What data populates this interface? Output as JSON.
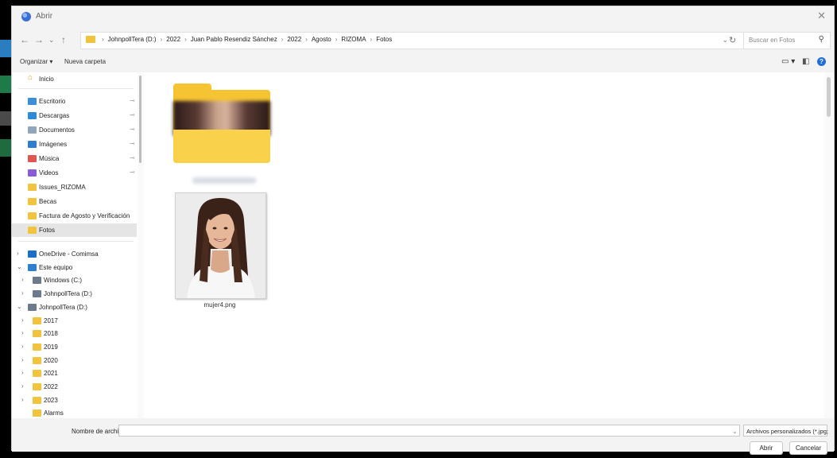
{
  "window": {
    "title": "Abrir"
  },
  "address": {
    "segments": [
      "JohnpollTera (D:)",
      "2022",
      "Juan Pablo Resendiz Sánchez",
      "2022",
      "Agosto",
      "RIZOMA",
      "Fotos"
    ]
  },
  "search": {
    "placeholder": "Buscar en Fotos"
  },
  "toolbar": {
    "organize": "Organizar ▾",
    "new_folder": "Nueva carpeta"
  },
  "sidebar": {
    "home": "Inicio",
    "quick": [
      {
        "label": "Escritorio",
        "icon": "desktop-icon",
        "pinned": true
      },
      {
        "label": "Descargas",
        "icon": "download-icon",
        "pinned": true
      },
      {
        "label": "Documentos",
        "icon": "documents-icon",
        "pinned": true
      },
      {
        "label": "Imágenes",
        "icon": "pictures-icon",
        "pinned": true
      },
      {
        "label": "Música",
        "icon": "music-icon",
        "pinned": true
      },
      {
        "label": "Videos",
        "icon": "videos-icon",
        "pinned": true
      },
      {
        "label": "Issues_RIZOMA",
        "icon": "folder-icon",
        "pinned": false
      },
      {
        "label": "Becas",
        "icon": "folder-icon",
        "pinned": false
      },
      {
        "label": "Factura de Agosto y Verificación",
        "icon": "folder-icon",
        "pinned": false
      },
      {
        "label": "Fotos",
        "icon": "folder-icon",
        "pinned": false,
        "selected": true
      }
    ],
    "tree": [
      {
        "label": "OneDrive - Comimsa",
        "icon": "onedrive-icon",
        "chev": ">",
        "indent": 0
      },
      {
        "label": "Este equipo",
        "icon": "computer-icon",
        "chev": "v",
        "indent": 0
      },
      {
        "label": "Windows (C:)",
        "icon": "drive-icon",
        "chev": ">",
        "indent": 1
      },
      {
        "label": "JohnpollTera (D:)",
        "icon": "drive-icon",
        "chev": ">",
        "indent": 1
      },
      {
        "label": "JohnpollTera (D:)",
        "icon": "drive-icon",
        "chev": "v",
        "indent": 0
      },
      {
        "label": "2017",
        "icon": "folder-icon",
        "chev": ">",
        "indent": 1
      },
      {
        "label": "2018",
        "icon": "folder-icon",
        "chev": ">",
        "indent": 1
      },
      {
        "label": "2019",
        "icon": "folder-icon",
        "chev": ">",
        "indent": 1
      },
      {
        "label": "2020",
        "icon": "folder-icon",
        "chev": ">",
        "indent": 1
      },
      {
        "label": "2021",
        "icon": "folder-icon",
        "chev": ">",
        "indent": 1
      },
      {
        "label": "2022",
        "icon": "folder-icon",
        "chev": ">",
        "indent": 1
      },
      {
        "label": "2023",
        "icon": "folder-icon",
        "chev": ">",
        "indent": 1
      },
      {
        "label": "Alarms",
        "icon": "folder-icon",
        "chev": "",
        "indent": 1
      }
    ]
  },
  "content": {
    "files": [
      {
        "name": "mujer4.png"
      }
    ]
  },
  "footer": {
    "filename_label": "Nombre de archivo:",
    "filename_value": "",
    "filetype": "Archivos personalizados (*.jpg;",
    "open": "Abrir",
    "cancel": "Cancelar"
  },
  "colors": {
    "folder": "#f6c432",
    "accent": "#1f6fd6",
    "selection": "#e5e5e5"
  }
}
